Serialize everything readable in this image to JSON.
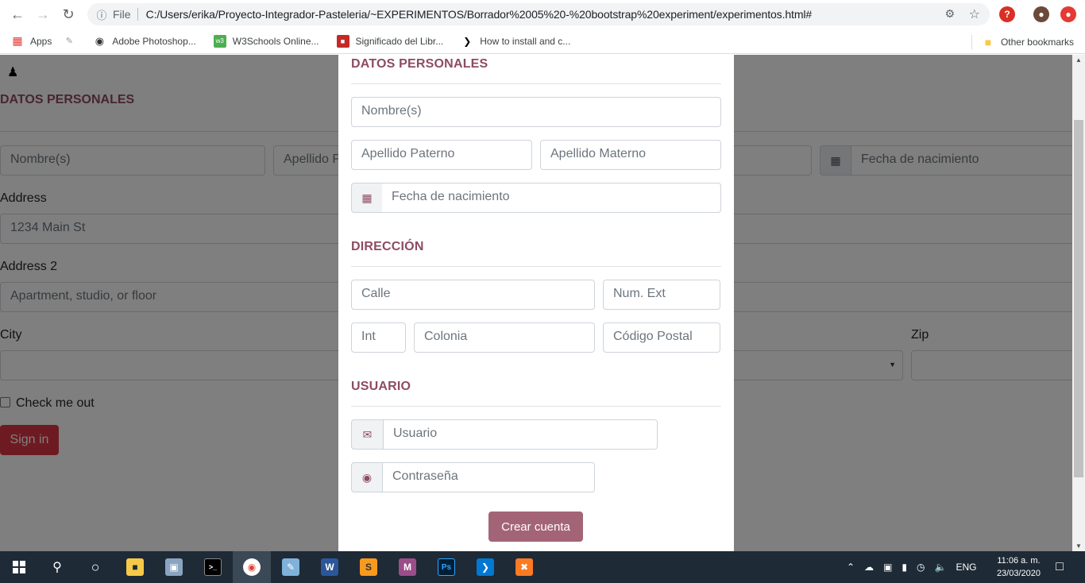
{
  "browser": {
    "omnibox_scheme": "File",
    "url": "C:/Users/erika/Proyecto-Integrador-Pasteleria/~EXPERIMENTOS/Borrador%2005%20-%20bootstrap%20experiment/experimentos.html#",
    "bookmarks": [
      {
        "label": "Apps",
        "icon": "apps-grid-icon"
      },
      {
        "label": "",
        "icon": "bookmark-favicon-icon"
      },
      {
        "label": "Adobe Photoshop...",
        "icon": "globe-icon"
      },
      {
        "label": "W3Schools Online...",
        "icon": "w3schools-icon"
      },
      {
        "label": "Significado del Libr...",
        "icon": "book-icon"
      },
      {
        "label": "How to install and c...",
        "icon": "cursor-icon"
      }
    ],
    "other_bookmarks": "Other bookmarks"
  },
  "background": {
    "section_title": "DATOS PERSONALES",
    "nombre_placeholder": "Nombre(s)",
    "apellido_placeholder": "Apellido P",
    "fecha_placeholder": "Fecha de nacimiento",
    "address_label": "Address",
    "address_placeholder": "1234 Main St",
    "address2_label": "Address 2",
    "address2_placeholder": "Apartment, studio, or floor",
    "city_label": "City",
    "zip_label": "Zip",
    "check_label": "Check me out",
    "signin_label": "Sign in"
  },
  "modal": {
    "datos_title": "DATOS PERSONALES",
    "nombre": "Nombre(s)",
    "apellido_paterno": "Apellido Paterno",
    "apellido_materno": "Apellido Materno",
    "fecha_nacimiento": "Fecha de nacimiento",
    "direccion_title": "DIRECCIÓN",
    "calle": "Calle",
    "num_ext": "Num. Ext",
    "int": "Int",
    "colonia": "Colonia",
    "codigo_postal": "Código Postal",
    "usuario_title": "USUARIO",
    "usuario": "Usuario",
    "contrasena": "Contraseña",
    "submit_label": "Crear cuenta"
  },
  "taskbar": {
    "language": "ENG",
    "time": "11:06 a. m.",
    "date": "23/03/2020"
  },
  "colors": {
    "accent": "#8e4b61",
    "button": "#a46478",
    "danger": "#dc3545"
  }
}
